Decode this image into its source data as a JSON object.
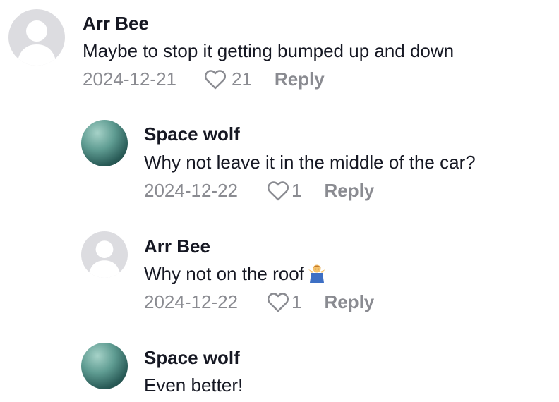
{
  "comments": [
    {
      "username": "Arr Bee",
      "text": "Maybe to stop it getting bumped up and down",
      "date": "2024-12-21",
      "likes": "21",
      "reply_label": "Reply",
      "avatar": "default-avatar"
    },
    {
      "username": "Space wolf",
      "text": "Why not leave it in the middle of the car?",
      "date": "2024-12-22",
      "likes": "1",
      "reply_label": "Reply",
      "avatar": "teal-gradient-avatar"
    },
    {
      "username": "Arr Bee",
      "text": "Why not on the roof",
      "emoji": "man-shrugging-emoji",
      "date": "2024-12-22",
      "likes": "1",
      "reply_label": "Reply",
      "avatar": "default-avatar"
    },
    {
      "username": "Space wolf",
      "text": "Even better!",
      "avatar": "teal-gradient-avatar"
    }
  ],
  "colors": {
    "text": "#161823",
    "muted": "#8a8b91",
    "avatar_default": "#dcdce0",
    "avatar_teal": "#2a5c58"
  }
}
